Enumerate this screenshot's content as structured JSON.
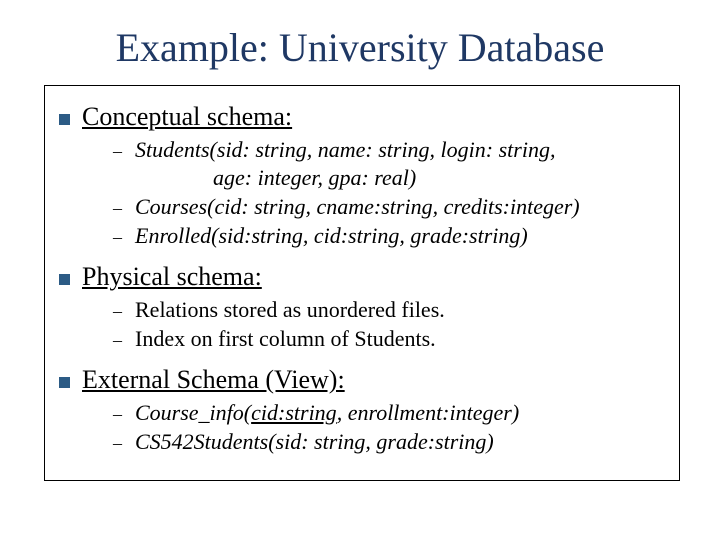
{
  "title": "Example: University Database",
  "sections": [
    {
      "heading": "Conceptual schema:",
      "items": [
        {
          "line1": "Students(sid: string, name: string, login: string,",
          "cont": "age: integer, gpa: real)",
          "italic": true
        },
        {
          "line1": "Courses(cid: string, cname:string, credits:integer)",
          "italic": true
        },
        {
          "line1": "Enrolled(sid:string, cid:string, grade:string)",
          "italic": true
        }
      ]
    },
    {
      "heading": "Physical schema:",
      "items": [
        {
          "line1": "Relations stored as unordered files.",
          "italic": false
        },
        {
          "line1": "Index on first column of Students.",
          "italic": false
        }
      ]
    },
    {
      "heading": "External Schema (View):",
      "items": [
        {
          "pre": "Course_info(",
          "uline": "cid:string",
          "post": ", enrollment:integer)",
          "italic": true,
          "special": true
        },
        {
          "line1": "CS542Students(sid: string, grade:string)",
          "italic": true
        }
      ]
    }
  ]
}
